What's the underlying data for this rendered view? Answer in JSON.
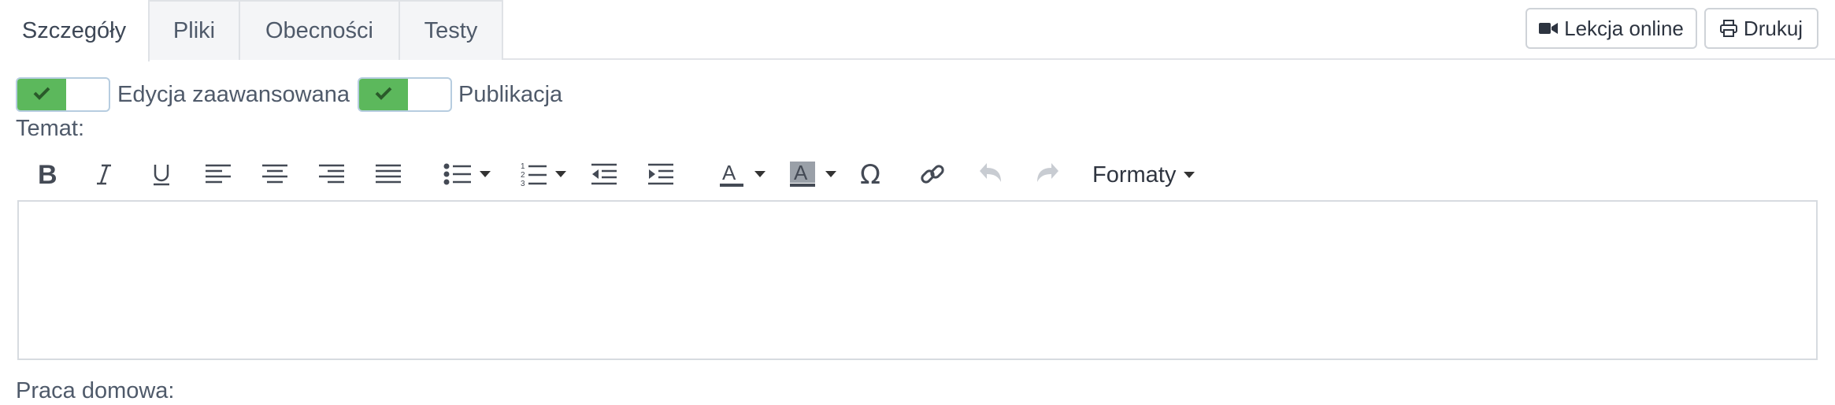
{
  "tabs": [
    {
      "label": "Szczegóły",
      "active": true
    },
    {
      "label": "Pliki",
      "active": false
    },
    {
      "label": "Obecności",
      "active": false
    },
    {
      "label": "Testy",
      "active": false
    }
  ],
  "actions": {
    "online_label": "Lekcja online",
    "online_icon": "video-camera-icon",
    "print_label": "Drukuj",
    "print_icon": "printer-icon"
  },
  "toggles": [
    {
      "label": "Edycja zaawansowana",
      "checked": true
    },
    {
      "label": "Publikacja",
      "checked": true
    }
  ],
  "fields": {
    "topic_label": "Temat:",
    "homework_label": "Praca domowa:",
    "topic_value": ""
  },
  "editor_toolbar": {
    "buttons": [
      "bold-icon",
      "italic-icon",
      "underline-icon",
      "align-left-icon",
      "align-center-icon",
      "align-right-icon",
      "align-justify-icon",
      "bullet-list-icon",
      "numbered-list-icon",
      "outdent-icon",
      "indent-icon",
      "text-color-icon",
      "background-color-icon",
      "special-character-icon",
      "link-icon",
      "undo-icon",
      "redo-icon"
    ],
    "formats_label": "Formaty"
  },
  "colors": {
    "toggle_on": "#5cb85c",
    "text": "#4f5a6a",
    "border": "#d7dbe0"
  }
}
